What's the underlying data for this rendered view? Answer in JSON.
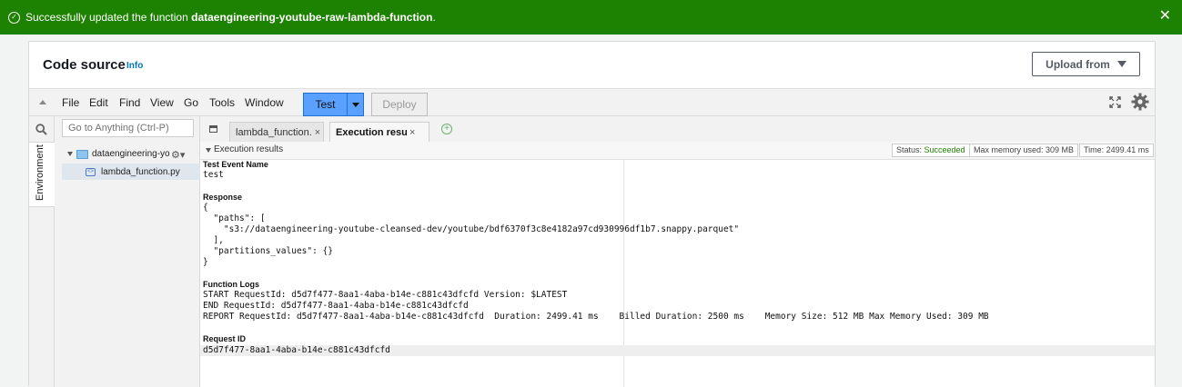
{
  "banner": {
    "message_prefix": "Successfully updated the function ",
    "function_name": "dataengineering-youtube-raw-lambda-function",
    "message_suffix": "."
  },
  "panel": {
    "title": "Code source",
    "info": "Info",
    "upload_label": "Upload from"
  },
  "menu": {
    "items": [
      "File",
      "Edit",
      "Find",
      "View",
      "Go",
      "Tools",
      "Window"
    ],
    "test_label": "Test",
    "deploy_label": "Deploy"
  },
  "sidebar": {
    "goto_placeholder": "Go to Anything (Ctrl-P)",
    "environment_label": "Environment",
    "folder_name": "dataengineering-yo",
    "file_name": "lambda_function.py"
  },
  "tabs": {
    "inactive_label": "lambda_function.",
    "active_label": "Execution results"
  },
  "results": {
    "header": "Execution results",
    "status_label": "Status: ",
    "status_value": "Succeeded",
    "max_memory": "Max memory used: 309 MB",
    "time": "Time: 2499.41 ms",
    "test_event_label": "Test Event Name",
    "test_event_value": "test",
    "response_label": "Response",
    "response_lines": [
      "{",
      "  \"paths\": [",
      "    \"s3://dataengineering-youtube-cleansed-dev/youtube/bdf6370f3c8e4182a97cd930996df1b7.snappy.parquet\"",
      "  ],",
      "  \"partitions_values\": {}",
      "}"
    ],
    "logs_label": "Function Logs",
    "log_lines": [
      "START RequestId: d5d7f477-8aa1-4aba-b14e-c881c43dfcfd Version: $LATEST",
      "END RequestId: d5d7f477-8aa1-4aba-b14e-c881c43dfcfd",
      "REPORT RequestId: d5d7f477-8aa1-4aba-b14e-c881c43dfcfd  Duration: 2499.41 ms    Billed Duration: 2500 ms    Memory Size: 512 MB Max Memory Used: 309 MB"
    ],
    "request_id_label": "Request ID",
    "request_id_value": "d5d7f477-8aa1-4aba-b14e-c881c43dfcfd"
  },
  "colors": {
    "banner_bg": "#1d8102",
    "test_button": "#5aa0ff",
    "link": "#0073bb"
  }
}
